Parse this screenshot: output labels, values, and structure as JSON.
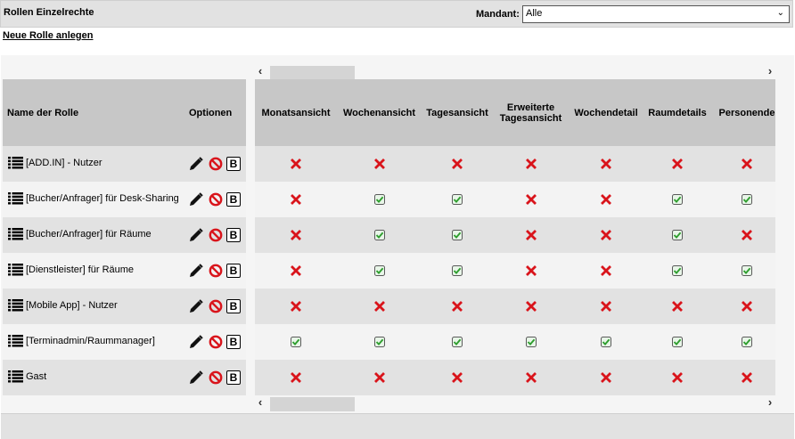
{
  "header": {
    "title": "Rollen Einzelrechte",
    "mandant_label": "Mandant:",
    "mandant_value": "Alle"
  },
  "actions": {
    "new_role": "Neue Rolle anlegen"
  },
  "table": {
    "col_name": "Name der Rolle",
    "col_options": "Optionen",
    "permission_columns": [
      "Monatsansicht",
      "Wochenansicht",
      "Tagesansicht",
      "Erweiterte Tagesansicht",
      "Wochendetail",
      "Raumdetails",
      "Personende"
    ],
    "rows": [
      {
        "name": "[ADD.IN] - Nutzer",
        "perms": [
          false,
          false,
          false,
          false,
          false,
          false,
          false
        ]
      },
      {
        "name": "[Bucher/Anfrager] für Desk-Sharing",
        "perms": [
          false,
          true,
          true,
          false,
          false,
          true,
          true
        ]
      },
      {
        "name": "[Bucher/Anfrager] für Räume",
        "perms": [
          false,
          true,
          true,
          false,
          false,
          true,
          false
        ]
      },
      {
        "name": "[Dienstleister] für Räume",
        "perms": [
          false,
          true,
          true,
          false,
          false,
          true,
          true
        ]
      },
      {
        "name": "[Mobile App] - Nutzer",
        "perms": [
          false,
          false,
          false,
          false,
          false,
          false,
          false
        ]
      },
      {
        "name": "[Terminadmin/Raummanager]",
        "perms": [
          true,
          true,
          true,
          true,
          true,
          true,
          true
        ]
      },
      {
        "name": "Gast",
        "perms": [
          false,
          false,
          false,
          false,
          false,
          false,
          false
        ]
      }
    ],
    "option_icons": [
      "edit-pencil-icon",
      "delete-forbidden-icon",
      "b-icon"
    ],
    "b_label": "B"
  },
  "colors": {
    "deny": "#d9141b",
    "allow": "#2e9e2e",
    "header_bg": "#c7c7c7"
  }
}
